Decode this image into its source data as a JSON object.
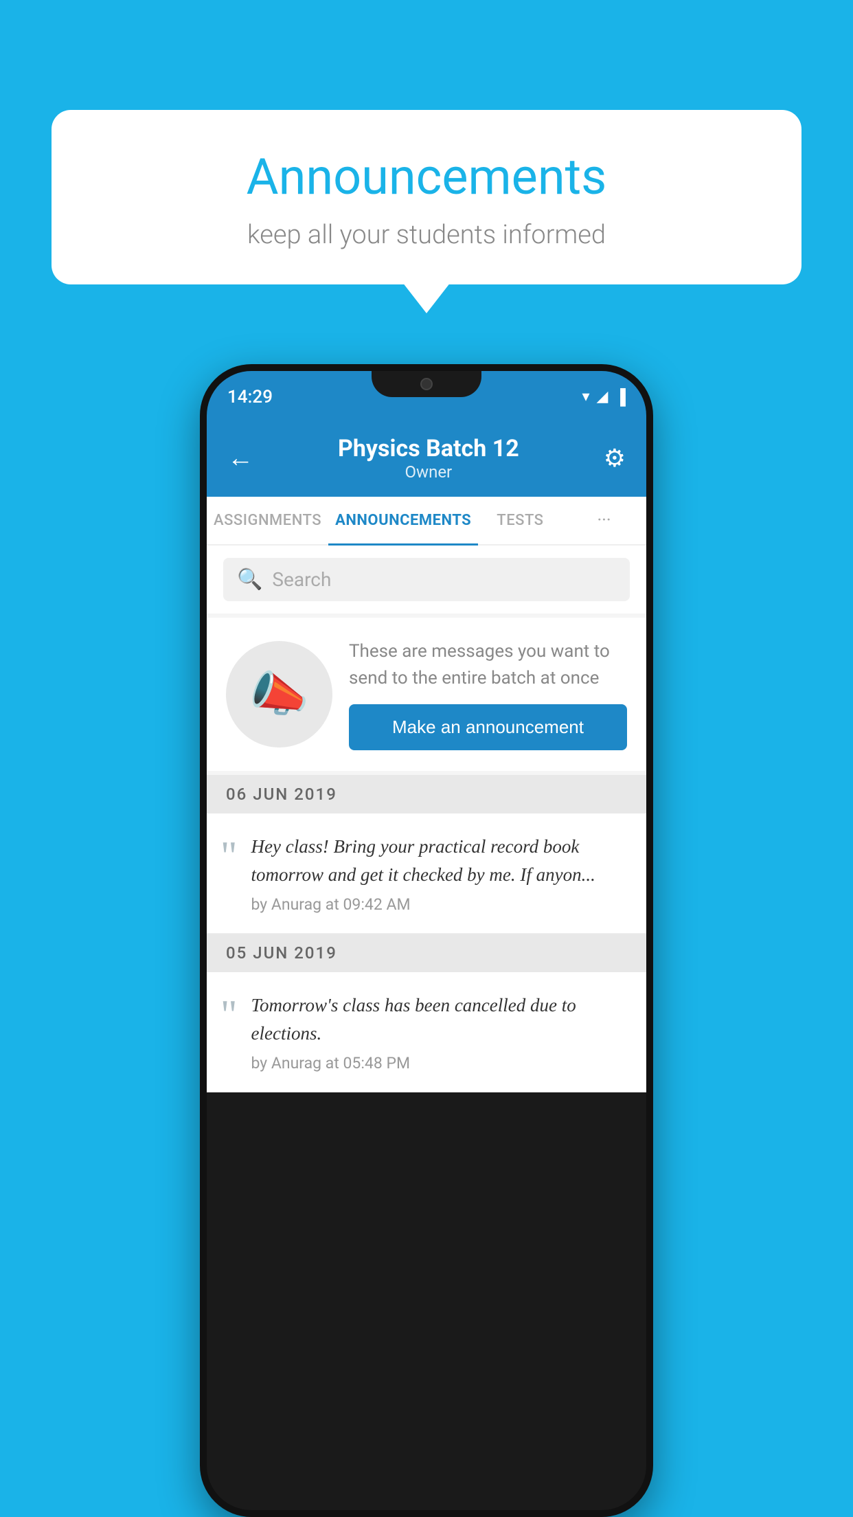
{
  "background_color": "#1ab3e8",
  "speech_bubble": {
    "title": "Announcements",
    "subtitle": "keep all your students informed"
  },
  "phone": {
    "status_bar": {
      "time": "14:29",
      "icons": "▼◄▐"
    },
    "header": {
      "back_label": "←",
      "title": "Physics Batch 12",
      "subtitle": "Owner",
      "gear_label": "⚙"
    },
    "tabs": [
      {
        "label": "ASSIGNMENTS",
        "active": false
      },
      {
        "label": "ANNOUNCEMENTS",
        "active": true
      },
      {
        "label": "TESTS",
        "active": false
      },
      {
        "label": "···",
        "active": false
      }
    ],
    "search": {
      "placeholder": "Search"
    },
    "promo": {
      "description": "These are messages you want to send to the entire batch at once",
      "button_label": "Make an announcement"
    },
    "announcements": [
      {
        "date": "06  JUN  2019",
        "text": "Hey class! Bring your practical record book tomorrow and get it checked by me. If anyon...",
        "meta": "by Anurag at 09:42 AM"
      },
      {
        "date": "05  JUN  2019",
        "text": "Tomorrow's class has been cancelled due to elections.",
        "meta": "by Anurag at 05:48 PM"
      }
    ]
  }
}
